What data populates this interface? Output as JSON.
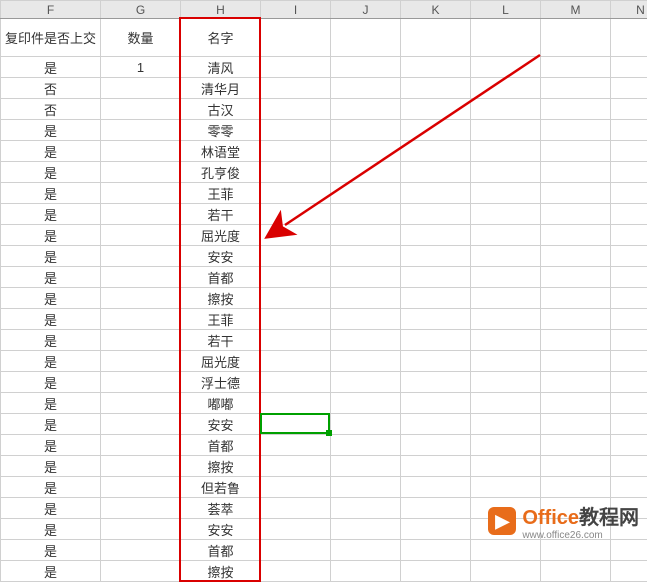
{
  "columns": [
    "F",
    "G",
    "H",
    "I",
    "J",
    "K",
    "L",
    "M",
    "N"
  ],
  "headers": {
    "F": "复印件是否上交",
    "G": "数量",
    "H": "名字"
  },
  "rows": [
    {
      "F": "是",
      "G": "1",
      "H": "清风"
    },
    {
      "F": "否",
      "G": "",
      "H": "清华月"
    },
    {
      "F": "否",
      "G": "",
      "H": "古汉"
    },
    {
      "F": "是",
      "G": "",
      "H": "零零"
    },
    {
      "F": "是",
      "G": "",
      "H": "林语堂"
    },
    {
      "F": "是",
      "G": "",
      "H": "孔亨俊"
    },
    {
      "F": "是",
      "G": "",
      "H": "王菲"
    },
    {
      "F": "是",
      "G": "",
      "H": "若干"
    },
    {
      "F": "是",
      "G": "",
      "H": "屈光度"
    },
    {
      "F": "是",
      "G": "",
      "H": "安安"
    },
    {
      "F": "是",
      "G": "",
      "H": "首都"
    },
    {
      "F": "是",
      "G": "",
      "H": "擦按"
    },
    {
      "F": "是",
      "G": "",
      "H": "王菲"
    },
    {
      "F": "是",
      "G": "",
      "H": "若干"
    },
    {
      "F": "是",
      "G": "",
      "H": "屈光度"
    },
    {
      "F": "是",
      "G": "",
      "H": "浮士德"
    },
    {
      "F": "是",
      "G": "",
      "H": "嘟嘟"
    },
    {
      "F": "是",
      "G": "",
      "H": "安安"
    },
    {
      "F": "是",
      "G": "",
      "H": "首都"
    },
    {
      "F": "是",
      "G": "",
      "H": "擦按"
    },
    {
      "F": "是",
      "G": "",
      "H": "但若鲁"
    },
    {
      "F": "是",
      "G": "",
      "H": "荟萃"
    },
    {
      "F": "是",
      "G": "",
      "H": "安安"
    },
    {
      "F": "是",
      "G": "",
      "H": "首都"
    },
    {
      "F": "是",
      "G": "",
      "H": "擦按"
    }
  ],
  "activeCell": {
    "col": "I",
    "rowIndex": 17
  },
  "highlightCol": "H",
  "watermark": {
    "brand1": "Office",
    "brand2": "教程网",
    "url": "www.office26.com"
  }
}
